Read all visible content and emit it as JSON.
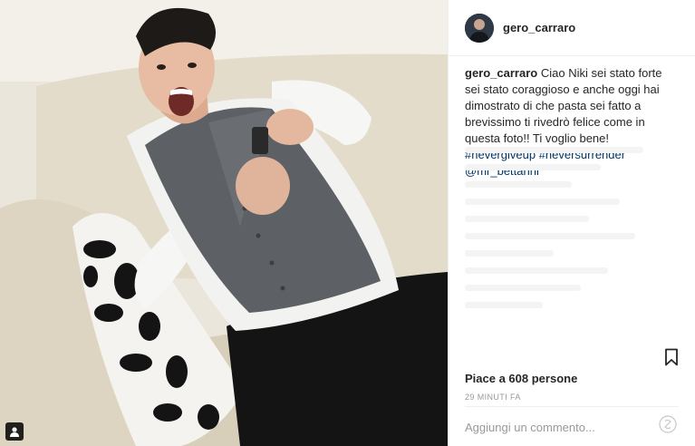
{
  "post": {
    "username": "gero_carraro",
    "follow_hint": "",
    "caption": {
      "username": "gero_carraro",
      "text": "Ciao Niki sei stato forte sei stato coraggioso e anche oggi hai dimostrato di che pasta sei fatto a brevissimo ti rivedrò felice come in questa foto!! Ti voglio bene!",
      "hashtag1": "#nevergiveup",
      "hashtag2": "#neversurrender",
      "mention": "@mr_bettarini"
    },
    "likes": "Piace a 608 persone",
    "time": "29 MINUTI FA",
    "comment_placeholder": "Aggiungi un commento...",
    "icons": {
      "bookmark": "bookmark-icon",
      "more": "more-options-icon",
      "tag": "user-tag-icon"
    },
    "colors": {
      "link": "#003569",
      "text": "#262626",
      "muted": "#999999"
    }
  }
}
